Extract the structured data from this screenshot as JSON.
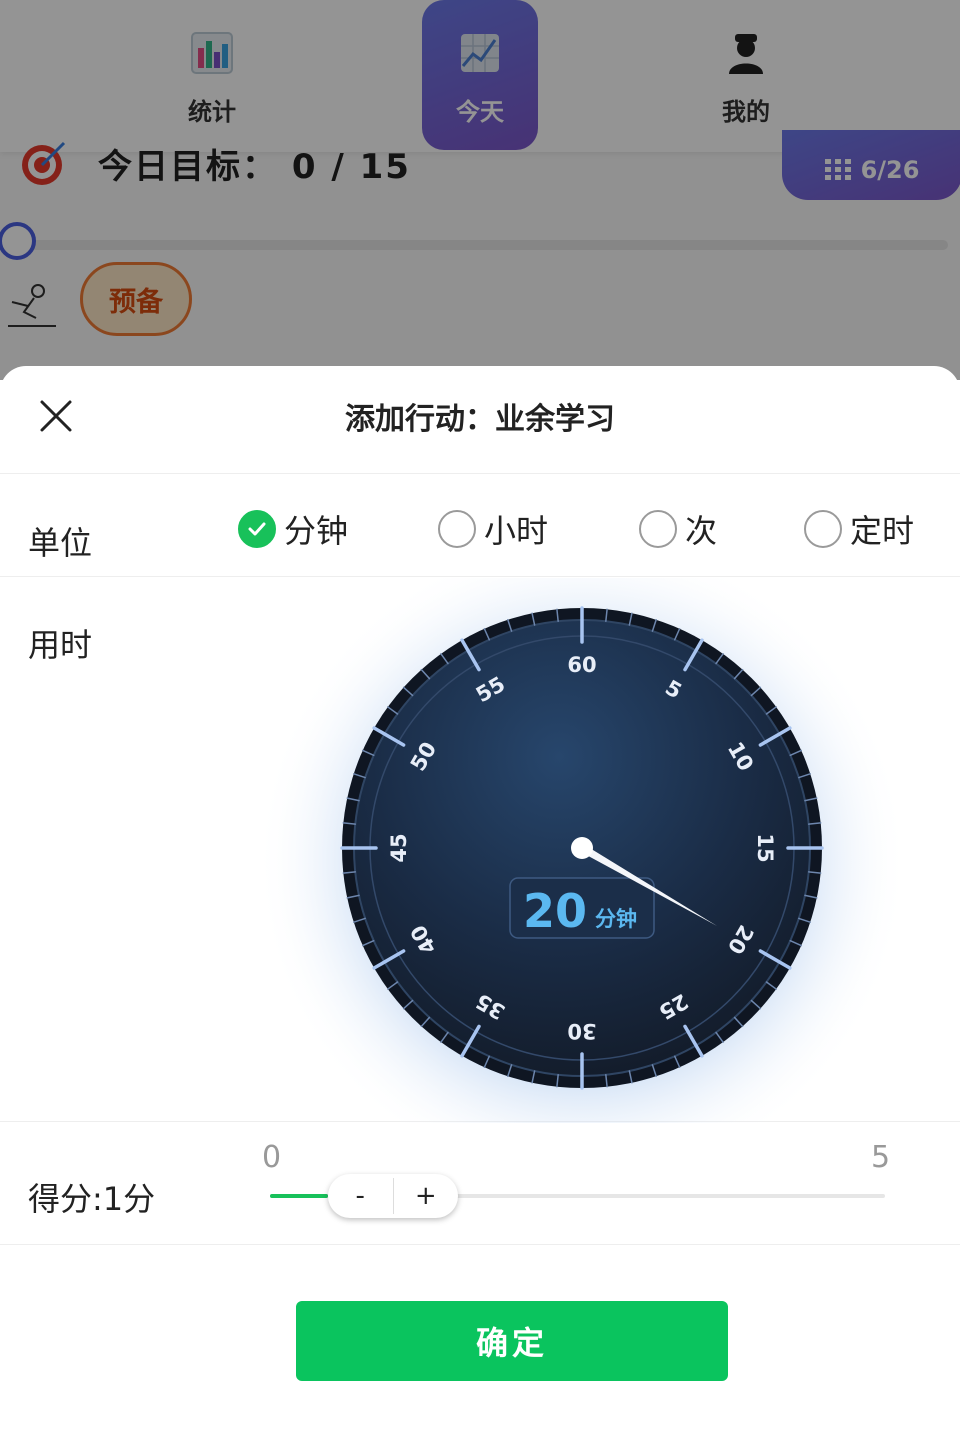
{
  "tabs": [
    {
      "label": "统计",
      "icon": "bar-chart-icon"
    },
    {
      "label": "今天",
      "icon": "trend-chart-icon"
    },
    {
      "label": "我的",
      "icon": "user-icon"
    }
  ],
  "background": {
    "goal_text": "今日目标： 0 / 15",
    "date_label": "6/26",
    "prep_label": "预备"
  },
  "sheet": {
    "title": "添加行动：业余学习",
    "unit_label": "单位",
    "units": [
      {
        "label": "分钟",
        "selected": true
      },
      {
        "label": "小时",
        "selected": false
      },
      {
        "label": "次",
        "selected": false
      },
      {
        "label": "定时",
        "selected": false
      }
    ],
    "time_label": "用时",
    "dial": {
      "value": 20,
      "value_text": "20",
      "unit": "分钟",
      "max": 60,
      "numbers": [
        "60",
        "5",
        "10",
        "15",
        "20",
        "25",
        "30",
        "35",
        "40",
        "45",
        "50",
        "55"
      ]
    },
    "score": {
      "label": "得分:1分",
      "min_label": "0",
      "max_label": "5",
      "min": 0,
      "max": 5,
      "value": 1,
      "minus_label": "-",
      "plus_label": "+"
    },
    "confirm_label": "确定"
  },
  "colors": {
    "accent_green": "#0ac45e",
    "tab_active_gradient": [
      "#6b79e8",
      "#7b57c9"
    ],
    "dial_face": "#1a2a40",
    "dial_tick": "#9ab8ec",
    "dial_value": "#5bb8f0"
  }
}
